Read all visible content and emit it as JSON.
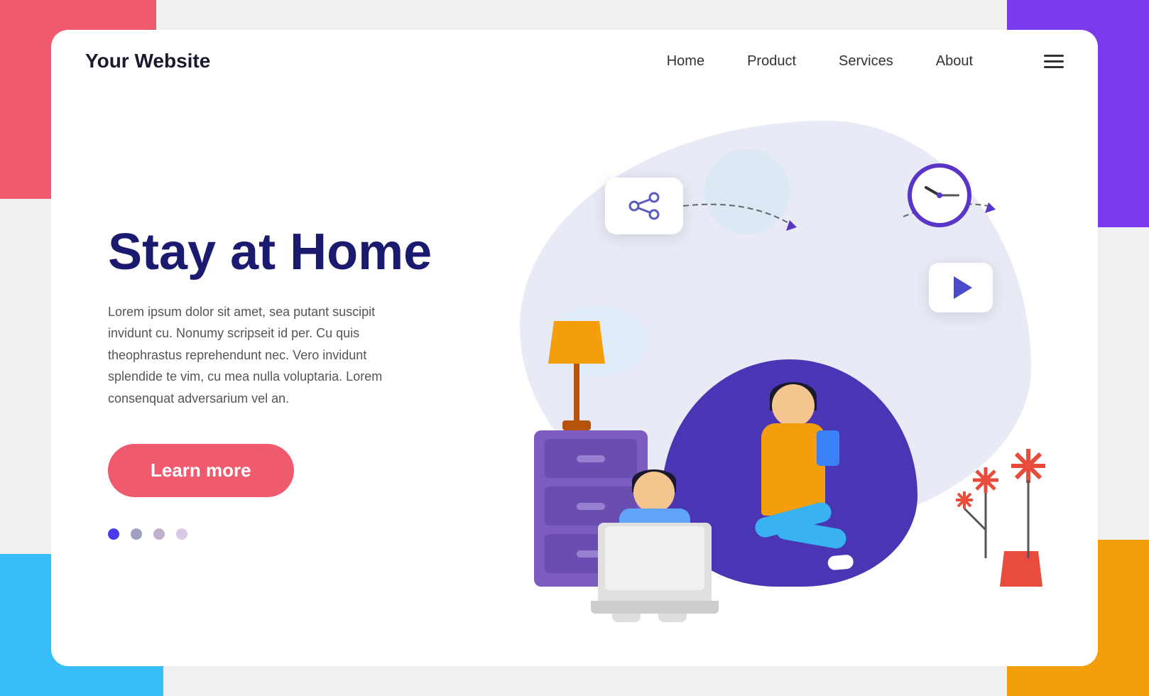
{
  "background_colors": {
    "tl": "#f05a6e",
    "tr": "#7c3aed",
    "bl": "#38bdf8",
    "br": "#f59e0b"
  },
  "header": {
    "logo": "Your Website",
    "nav": {
      "home": "Home",
      "product": "Product",
      "services": "Services",
      "about": "About"
    }
  },
  "hero": {
    "title": "Stay at Home",
    "description": "Lorem ipsum dolor sit amet, sea putant suscipit invidunt cu. Nonumy scripseit id per. Cu quis theophrastus reprehendunt nec. Vero invidunt splendide te vim, cu mea nulla voluptaria. Lorem consenquat adversarium vel an.",
    "cta_button": "Learn more",
    "dots_count": 4
  }
}
